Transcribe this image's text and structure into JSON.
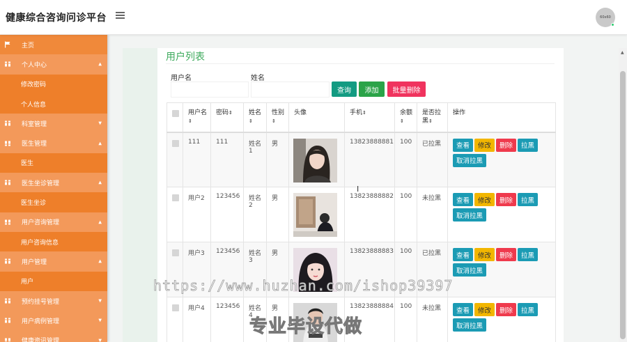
{
  "header": {
    "app_title": "健康综合咨询问诊平台",
    "avatar_text": "60x60"
  },
  "sidebar": {
    "items": [
      {
        "label": "主页",
        "type": "first"
      },
      {
        "label": "个人中心",
        "type": "parent",
        "caret": "▲"
      },
      {
        "label": "修改密码",
        "type": "child"
      },
      {
        "label": "个人信息",
        "type": "child"
      },
      {
        "label": "科室管理",
        "type": "parent",
        "caret": "▼"
      },
      {
        "label": "医生管理",
        "type": "parent",
        "caret": "▲"
      },
      {
        "label": "医生",
        "type": "child"
      },
      {
        "label": "医生坐诊管理",
        "type": "parent",
        "caret": "▲"
      },
      {
        "label": "医生坐诊",
        "type": "child"
      },
      {
        "label": "用户咨询管理",
        "type": "parent",
        "caret": "▲"
      },
      {
        "label": "用户咨询信息",
        "type": "child"
      },
      {
        "label": "用户管理",
        "type": "parent",
        "caret": "▲"
      },
      {
        "label": "用户",
        "type": "child"
      },
      {
        "label": "预约挂号管理",
        "type": "parent",
        "caret": "▼"
      },
      {
        "label": "用户病例管理",
        "type": "parent",
        "caret": "▼"
      },
      {
        "label": "健康资讯管理",
        "type": "parent",
        "caret": "▼"
      }
    ]
  },
  "panel": {
    "title": "用户列表",
    "search": {
      "username_label": "用户名",
      "name_label": "姓名",
      "username_value": "",
      "name_value": ""
    },
    "buttons": {
      "search": "查询",
      "add": "添加",
      "batch_delete": "批量删除"
    }
  },
  "table": {
    "headers": {
      "username": "用户名",
      "password": "密码",
      "name": "姓名",
      "gender": "性别",
      "avatar": "头像",
      "phone": "手机",
      "balance": "余额",
      "blacklisted": "是否拉黑",
      "actions": "操作"
    },
    "sort_glyph": "⇕",
    "row_actions": {
      "view": "查看",
      "edit": "修改",
      "delete": "删除",
      "ban": "拉黑",
      "unban": "取消拉黑"
    },
    "rows": [
      {
        "username": "111",
        "password": "111",
        "name": "姓名1",
        "gender": "男",
        "phone": "13823888881",
        "balance": "100",
        "blacklisted": "已拉黑"
      },
      {
        "username": "用户2",
        "password": "123456",
        "name": "姓名2",
        "gender": "男",
        "phone": "13823888882",
        "balance": "100",
        "blacklisted": "未拉黑"
      },
      {
        "username": "用户3",
        "password": "123456",
        "name": "姓名3",
        "gender": "男",
        "phone": "13823888883",
        "balance": "100",
        "blacklisted": "已拉黑"
      },
      {
        "username": "用户4",
        "password": "123456",
        "name": "姓名4",
        "gender": "男",
        "phone": "13823888884",
        "balance": "100",
        "blacklisted": "未拉黑"
      }
    ]
  },
  "watermark": {
    "url": "https://www.huzhan.com/ishop39397",
    "slogan": "专业毕设代做"
  },
  "colors": {
    "sidebar": "#f0893a",
    "title_green": "#3daa5c",
    "btn_teal": "#139b82",
    "btn_red": "#f0335e"
  }
}
